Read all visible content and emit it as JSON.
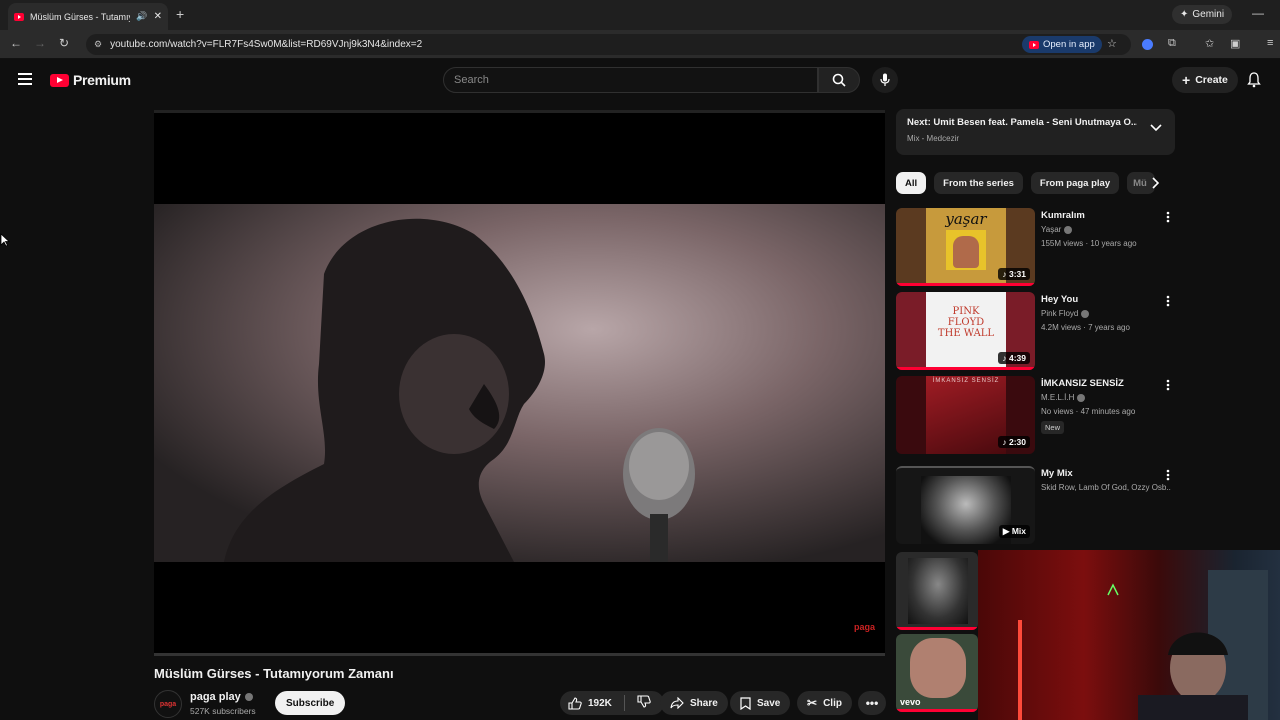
{
  "browser": {
    "tab_title": "Müslüm Gürses - Tutamıyor",
    "url": "youtube.com/watch?v=FLR7Fs4Sw0M&list=RD69VJnj9k3N4&index=2",
    "open_in_app": "Open in app",
    "gemini": "Gemini"
  },
  "header": {
    "logo": "Premium",
    "search_placeholder": "Search",
    "create": "Create"
  },
  "video": {
    "title": "Müslüm Gürses - Tutamıyorum Zamanı",
    "channel": "paga play",
    "channel_avatar": "paga",
    "subscribers": "527K subscribers",
    "subscribe": "Subscribe",
    "likes": "192K",
    "share": "Share",
    "save": "Save",
    "clip": "Clip",
    "watermark": "paga"
  },
  "next": {
    "title": "Next: Umit Besen feat. Pamela - Seni Unutmaya O...",
    "subtitle": "Mix - Medcezir"
  },
  "chips": [
    "All",
    "From the series",
    "From paga play",
    "Mü"
  ],
  "recommendations": [
    {
      "title": "Kumralım",
      "channel": "Yaşar",
      "meta": "155M views · 10 years ago",
      "duration": "3:31",
      "thumb_text": "yaşar"
    },
    {
      "title": "Hey You",
      "channel": "Pink Floyd",
      "meta": "4.2M views · 7 years ago",
      "duration": "4:39",
      "thumb_text": "PINK FLOYD THE WALL"
    },
    {
      "title": "İMKANSIZ SENSİZ",
      "channel": "M.E.L.İ.H",
      "meta": "No views · 47 minutes ago",
      "duration": "2:30",
      "badge": "New",
      "thumb_text": "İMKANSIZ SENSİZ"
    },
    {
      "title": "My Mix",
      "channel": "Skid Row, Lamb Of God, Ozzy Osb...",
      "meta": "",
      "duration": "Mix"
    },
    {
      "title": "",
      "channel": "",
      "meta": "",
      "duration": ""
    },
    {
      "title": "",
      "channel": "",
      "meta": "",
      "duration": "",
      "thumb_text": "vevo"
    }
  ],
  "colors": {
    "accent": "#ff0033",
    "background": "#0f0f0f",
    "chip": "#272727"
  }
}
